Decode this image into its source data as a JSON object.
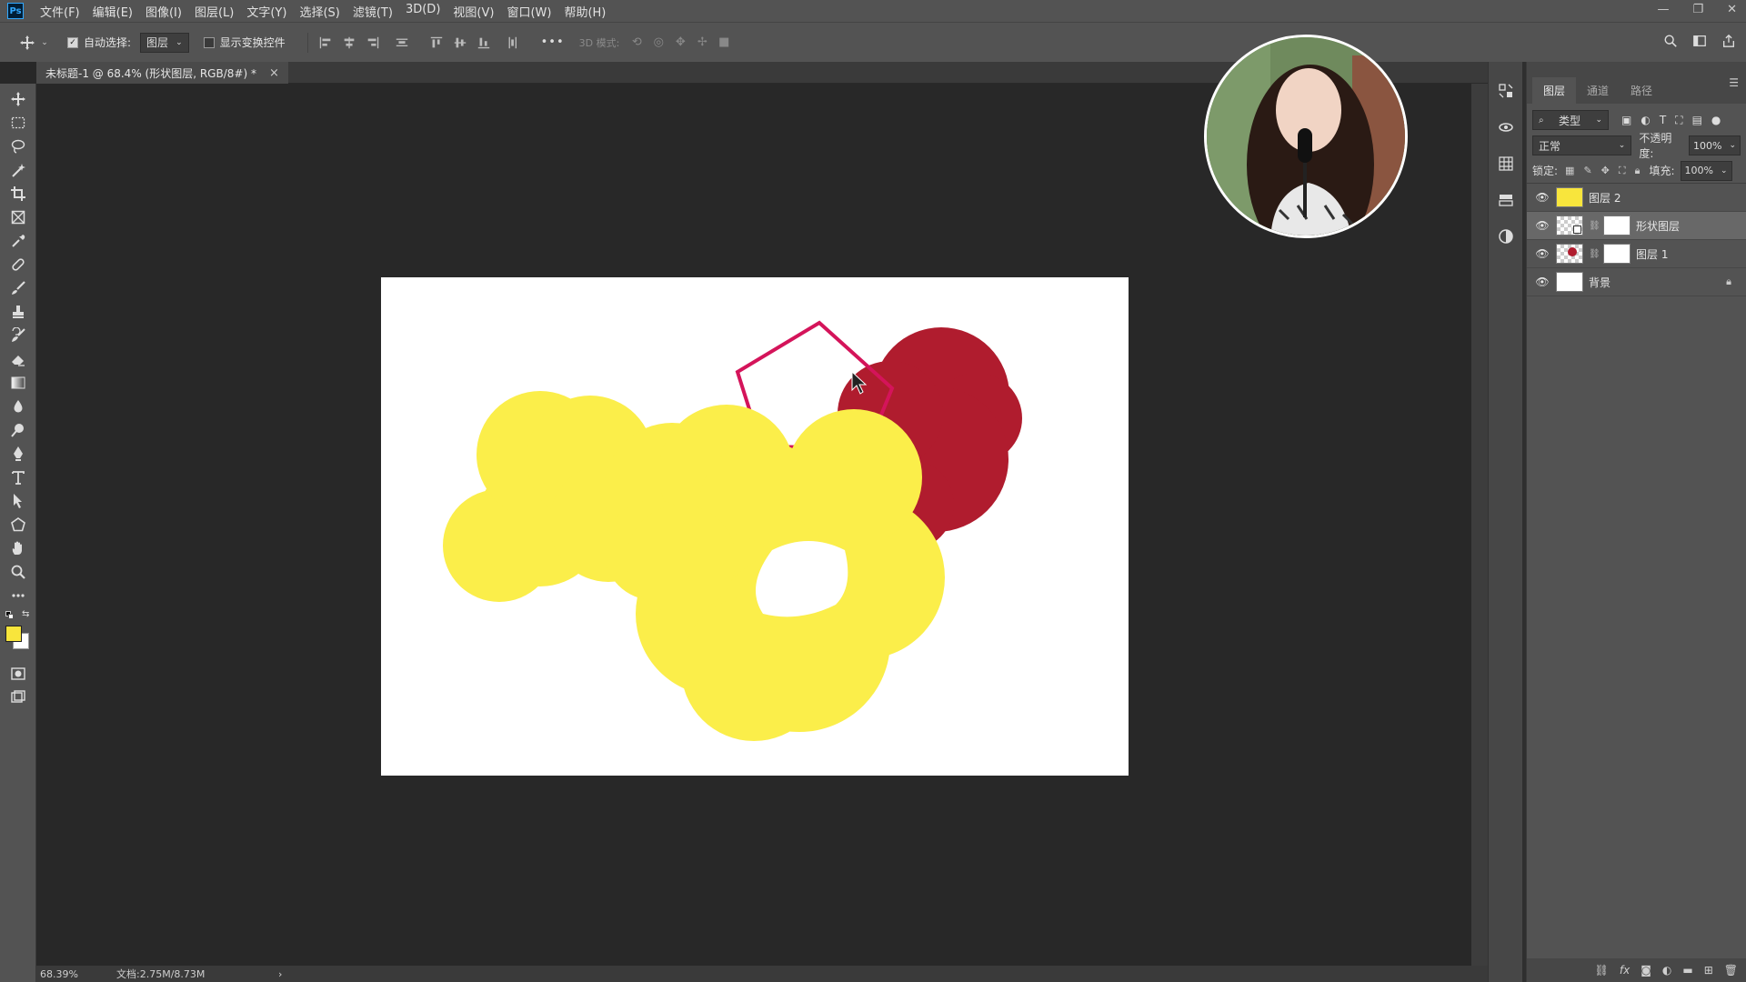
{
  "app": {
    "logo": "Ps"
  },
  "menubar": {
    "items": [
      "文件(F)",
      "编辑(E)",
      "图像(I)",
      "图层(L)",
      "文字(Y)",
      "选择(S)",
      "滤镜(T)",
      "3D(D)",
      "视图(V)",
      "窗口(W)",
      "帮助(H)"
    ],
    "window_controls": [
      "—",
      "❐",
      "✕"
    ]
  },
  "options": {
    "auto_select_label": "自动选择:",
    "auto_select_checked": true,
    "auto_select_target": "图层",
    "show_transform_label": "显示变换控件",
    "show_transform_checked": false,
    "mode_3d_label": "3D 模式:",
    "more_label": "•••"
  },
  "document": {
    "tab_title": "未标题-1 @ 68.4% (形状图层, RGB/8#) *",
    "close": "×",
    "background_color": "#ffffff"
  },
  "status": {
    "zoom": "68.39%",
    "doc_size": "文档:2.75M/8.73M",
    "arrow": "›"
  },
  "tools": [
    "move-tool",
    "marquee-tool",
    "lasso-tool",
    "magic-wand-tool",
    "crop-tool",
    "frame-tool",
    "eyedropper-tool",
    "healing-brush-tool",
    "brush-tool",
    "clone-stamp-tool",
    "history-brush-tool",
    "eraser-tool",
    "gradient-tool",
    "blur-tool",
    "dodge-tool",
    "pen-tool",
    "type-tool",
    "path-selection-tool",
    "shape-tool",
    "hand-tool",
    "zoom-tool",
    "more-tools"
  ],
  "colors": {
    "foreground": "#f8e53c",
    "background": "#ffffff",
    "yellow_paint": "#fbee4a",
    "red_paint": "#b01c2e",
    "pentagon_stroke": "#d4145a"
  },
  "layers_panel": {
    "tabs": [
      "图层",
      "通道",
      "路径"
    ],
    "active_tab": "图层",
    "filter_label": "类型",
    "blend_mode": "正常",
    "opacity_label": "不透明度:",
    "opacity_value": "100%",
    "lock_label": "锁定:",
    "fill_label": "填充:",
    "fill_value": "100%",
    "layers": [
      {
        "name": "图层 2",
        "visible": true,
        "selected": false,
        "thumb": "yellow",
        "has_mask": false,
        "locked": false
      },
      {
        "name": "形状图层",
        "visible": true,
        "selected": true,
        "thumb": "shape",
        "has_mask": true,
        "locked": false
      },
      {
        "name": "图层 1",
        "visible": true,
        "selected": false,
        "thumb": "red",
        "has_mask": true,
        "locked": false
      },
      {
        "name": "背景",
        "visible": true,
        "selected": false,
        "thumb": "white",
        "has_mask": false,
        "locked": true
      }
    ]
  }
}
